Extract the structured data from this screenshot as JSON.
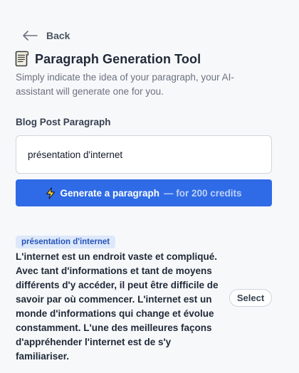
{
  "nav": {
    "back_label": "Back"
  },
  "header": {
    "title": "Paragraph Generation Tool",
    "subtitle": "Simply indicate the idea of your paragraph, your AI-assistant will generate one for you."
  },
  "form": {
    "field_label": "Blog Post Paragraph",
    "input_value": "présentation d'internet"
  },
  "generate_button": {
    "label": "Generate a paragraph",
    "suffix": "— for 200 credits"
  },
  "results": [
    {
      "tag": "présentation d'internet",
      "text": "L'internet est un endroit vaste et compliqué. Avec tant d'informations et tant de moyens différents d'y accéder, il peut être difficile de savoir par où commencer. L'internet est un monde d'informations qui change et évolue constamment. L'une des meilleures façons d'appréhender l'internet est de s'y familiariser.",
      "select_label": "Select"
    }
  ],
  "colors": {
    "accent": "#2f6be6",
    "tag_bg": "#dde8fb",
    "tag_text": "#2554b8",
    "page_bg": "#f7f8fa"
  },
  "icons": {
    "back": "arrow-left-icon",
    "title": "document-icon",
    "generate": "lightning-bolt-icon"
  }
}
